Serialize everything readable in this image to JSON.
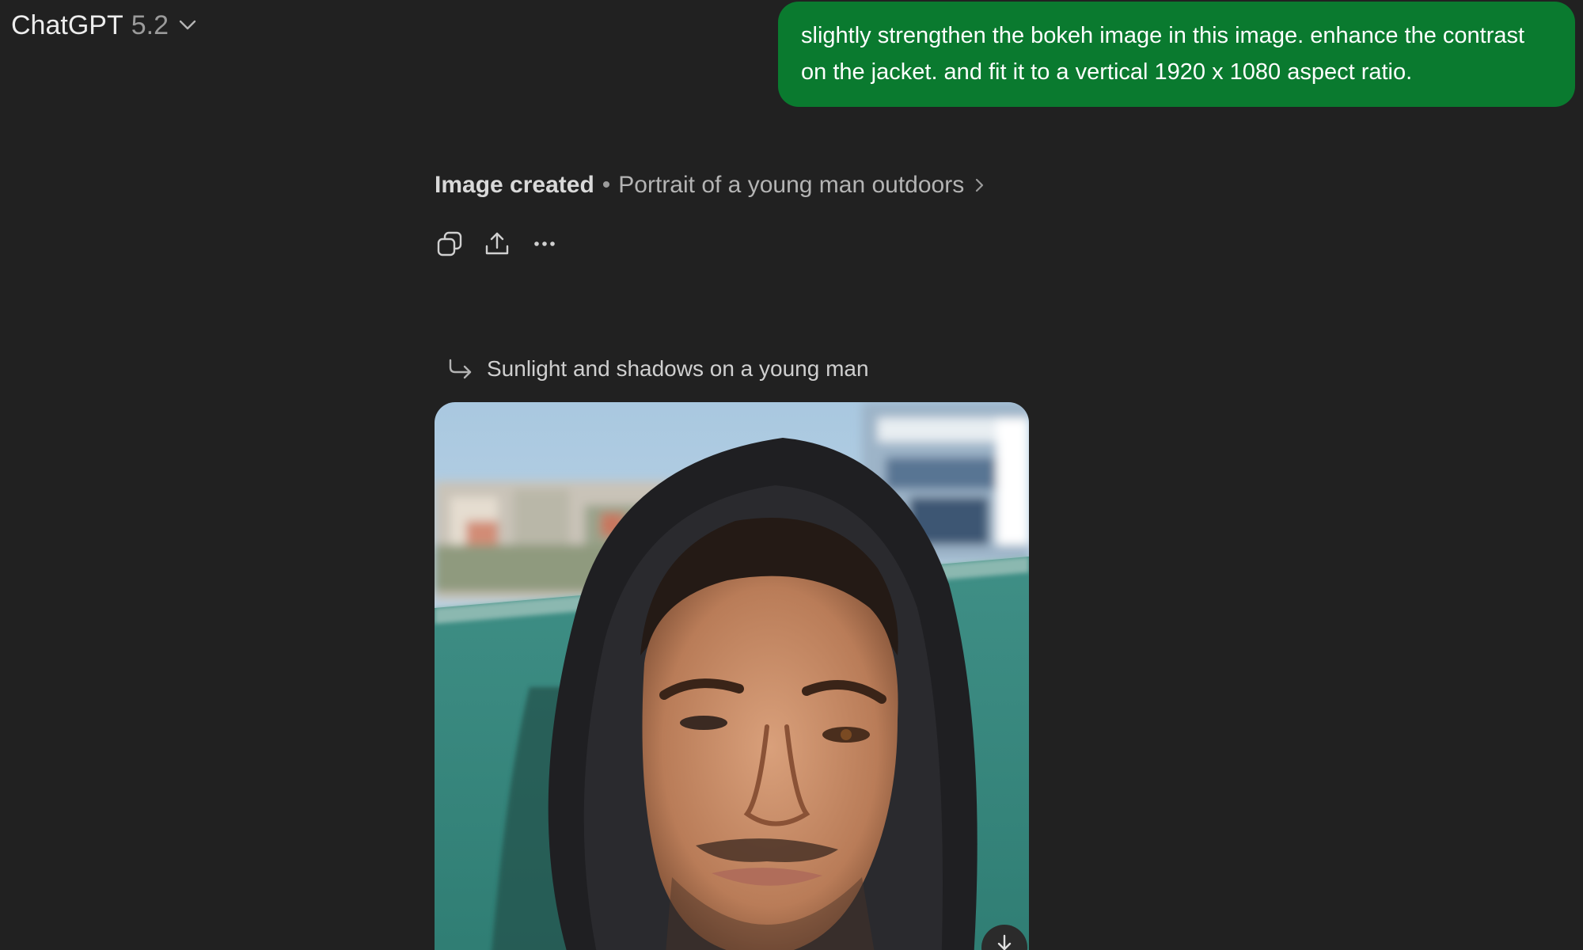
{
  "header": {
    "app_name": "ChatGPT",
    "model_version": "5.2"
  },
  "user_message": {
    "text": "slightly strengthen the bokeh image in this image. enhance the contrast on the jacket. and fit it to a vertical 1920 x 1080 aspect ratio.",
    "bubble_color": "#0a7a2f"
  },
  "response": {
    "status_label": "Image created",
    "separator": "•",
    "image_title": "Portrait of a young man outdoors",
    "actions": [
      {
        "icon": "copy-icon"
      },
      {
        "icon": "share-icon"
      },
      {
        "icon": "more-icon"
      }
    ],
    "sub_caption": "Sunlight and shadows on a young man",
    "image": {
      "subject": "portrait photo of a young man in a black hood, outdoor background with bokeh"
    }
  },
  "colors": {
    "background": "#212121",
    "text_primary": "#ececec",
    "text_secondary": "#b4b4b4"
  }
}
